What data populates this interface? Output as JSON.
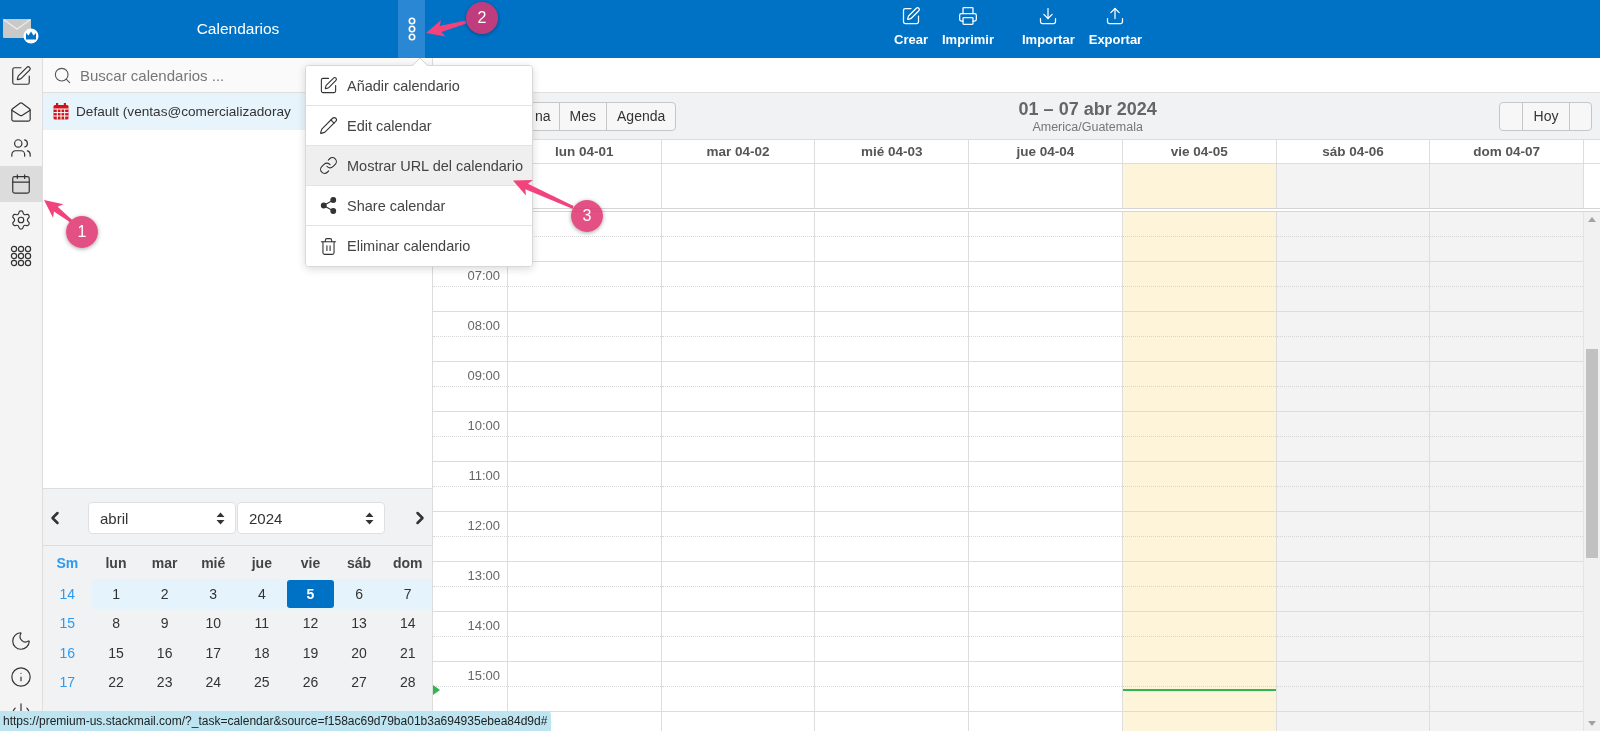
{
  "header": {
    "title": "Calendarios",
    "toolbar_groups": [
      {
        "buttons": [
          {
            "label": "Crear"
          },
          {
            "label": "Imprimir"
          }
        ]
      },
      {
        "buttons": [
          {
            "label": "Importar"
          },
          {
            "label": "Exportar"
          }
        ]
      }
    ]
  },
  "nav_rail": [
    {
      "selected": false
    },
    {
      "selected": false
    },
    {
      "selected": false
    },
    {
      "selected": true
    },
    {
      "selected": false
    },
    {
      "selected": false
    }
  ],
  "calendar_panel": {
    "search": {
      "placeholder": "Buscar calendarios ..."
    },
    "calendars": [
      {
        "name": "Default (ventas@comercializadoray",
        "selected": true
      }
    ]
  },
  "mini_calendar": {
    "month": "abril",
    "year": "2024",
    "week_header": "Sm",
    "weekdays": [
      "lun",
      "mar",
      "mié",
      "jue",
      "vie",
      "sáb",
      "dom"
    ],
    "weeks": [
      {
        "number": "14",
        "current": true,
        "days": [
          {
            "day": "1",
            "selected": false
          },
          {
            "day": "2",
            "selected": false
          },
          {
            "day": "3",
            "selected": false
          },
          {
            "day": "4",
            "selected": false
          },
          {
            "day": "5",
            "selected": true
          },
          {
            "day": "6",
            "selected": false
          },
          {
            "day": "7",
            "selected": false
          }
        ]
      },
      {
        "number": "15",
        "current": false,
        "days": [
          {
            "day": "8",
            "selected": false
          },
          {
            "day": "9",
            "selected": false
          },
          {
            "day": "10",
            "selected": false
          },
          {
            "day": "11",
            "selected": false
          },
          {
            "day": "12",
            "selected": false
          },
          {
            "day": "13",
            "selected": false
          },
          {
            "day": "14",
            "selected": false
          }
        ]
      },
      {
        "number": "16",
        "current": false,
        "days": [
          {
            "day": "15",
            "selected": false
          },
          {
            "day": "16",
            "selected": false
          },
          {
            "day": "17",
            "selected": false
          },
          {
            "day": "18",
            "selected": false
          },
          {
            "day": "19",
            "selected": false
          },
          {
            "day": "20",
            "selected": false
          },
          {
            "day": "21",
            "selected": false
          }
        ]
      },
      {
        "number": "17",
        "current": false,
        "days": [
          {
            "day": "22",
            "selected": false
          },
          {
            "day": "23",
            "selected": false
          },
          {
            "day": "24",
            "selected": false
          },
          {
            "day": "25",
            "selected": false
          },
          {
            "day": "26",
            "selected": false
          },
          {
            "day": "27",
            "selected": false
          },
          {
            "day": "28",
            "selected": false
          }
        ]
      }
    ]
  },
  "calendar_view": {
    "views": [
      {
        "label": "na"
      },
      {
        "label": "Mes"
      },
      {
        "label": "Agenda"
      }
    ],
    "title": "01 – 07 abr 2024",
    "timezone": "America/Guatemala",
    "today_button": "Hoy",
    "days": [
      {
        "label": "lun 04-01",
        "kind": "weekday"
      },
      {
        "label": "mar 04-02",
        "kind": "weekday"
      },
      {
        "label": "mié 04-03",
        "kind": "weekday"
      },
      {
        "label": "jue 04-04",
        "kind": "weekday"
      },
      {
        "label": "vie 04-05",
        "kind": "today"
      },
      {
        "label": "sáb 04-06",
        "kind": "weekend"
      },
      {
        "label": "dom 04-07",
        "kind": "weekend"
      }
    ],
    "hours": [
      "07:00",
      "08:00",
      "09:00",
      "10:00",
      "11:00",
      "12:00",
      "13:00",
      "14:00",
      "15:00"
    ]
  },
  "context_menu": {
    "items": [
      {
        "label": "Añadir calendario",
        "selected": false
      },
      {
        "label": "Edit calendar",
        "selected": false
      },
      {
        "label": "Mostrar URL del calendario",
        "selected": true
      },
      {
        "label": "Share calendar",
        "selected": false
      },
      {
        "label": "Eliminar calendario",
        "selected": false
      }
    ]
  },
  "status_url": "https://premium-us.stackmail.com/?_task=calendar&source=f158ac69d79ba01b3a694935ebea84d9d#",
  "annotations": [
    {
      "number": "1"
    },
    {
      "number": "2"
    },
    {
      "number": "3"
    }
  ]
}
